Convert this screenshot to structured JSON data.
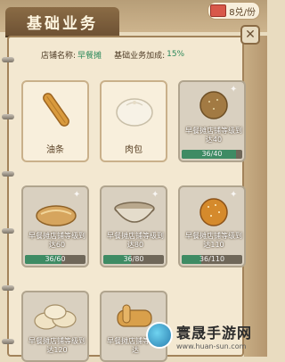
{
  "header": {
    "title": "基础业务",
    "currency_value": "8兑/份"
  },
  "info": {
    "shop_name_label": "店铺名称:",
    "shop_name": "早餐摊",
    "bonus_label": "基础业务加成:",
    "bonus_value": "15%"
  },
  "cards": [
    {
      "name": "油条",
      "unlocked": true,
      "icon": "youtiao-icon"
    },
    {
      "name": "肉包",
      "unlocked": true,
      "icon": "baozi-icon"
    },
    {
      "requirement": "早餐摊店铺等级到达40",
      "progress_text": "36/40",
      "progress": 0.9,
      "icon": "round-bread-icon"
    },
    {
      "requirement": "早餐摊店铺等级到达60",
      "progress_text": "36/60",
      "progress": 0.6,
      "icon": "pancake-icon"
    },
    {
      "requirement": "早餐摊店铺等级到达80",
      "progress_text": "36/80",
      "progress": 0.45,
      "icon": "soup-bowl-icon"
    },
    {
      "requirement": "早餐摊店铺等级到达110",
      "progress_text": "36/110",
      "progress": 0.33,
      "icon": "sesame-ball-icon"
    },
    {
      "requirement": "早餐摊店铺等级到达120",
      "icon": "dumplings-icon"
    },
    {
      "requirement": "早餐摊店铺等级到达",
      "icon": "fried-food-icon"
    }
  ],
  "watermark": {
    "title": "寰晟手游网",
    "url": "www.huan-sun.com"
  },
  "colors": {
    "progress_fill": "#3e8b64",
    "accent_green": "#2d8a5c",
    "panel_bg": "#f3e8d1"
  }
}
